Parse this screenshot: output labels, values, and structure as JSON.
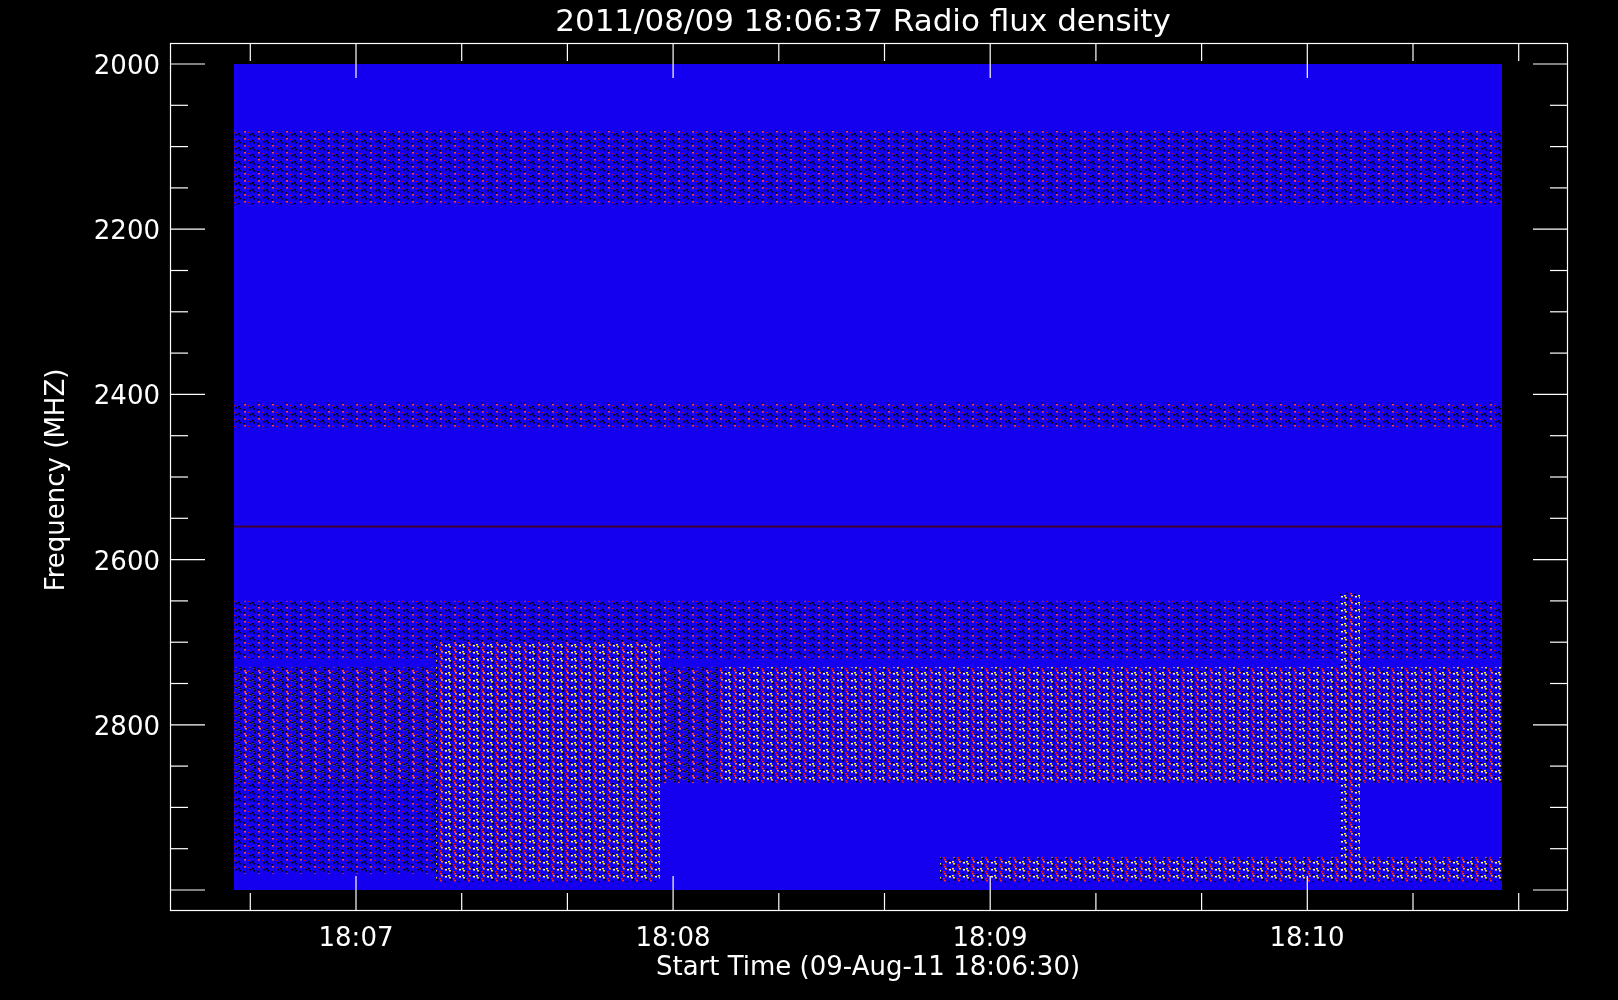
{
  "title": "2011/08/09 18:06:37 Radio flux density",
  "y_axis": {
    "label": "Frequency (MHZ)",
    "ticks": [
      "2000",
      "2200",
      "2400",
      "2600",
      "2800"
    ]
  },
  "x_axis": {
    "label": "Start Time (09-Aug-11 18:06:30)",
    "ticks": [
      "18:07",
      "18:08",
      "18:09",
      "18:10"
    ]
  }
}
